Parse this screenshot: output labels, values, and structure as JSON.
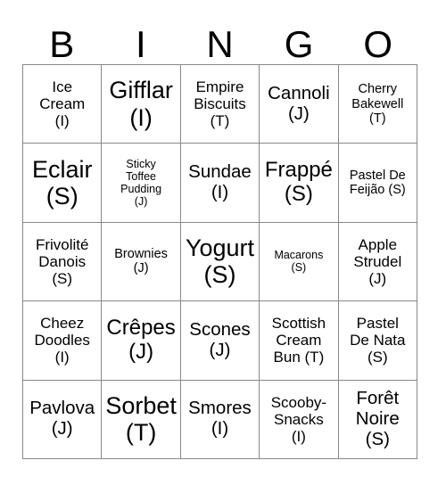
{
  "card": {
    "header": {
      "letters": [
        "B",
        "I",
        "N",
        "G",
        "O"
      ]
    },
    "grid": {
      "rows": 5,
      "columns": 5,
      "cells": [
        {
          "text": "Ice\nCream\n(I)",
          "size": "m"
        },
        {
          "text": "Gifflar\n(I)",
          "size": "xxl"
        },
        {
          "text": "Empire\nBiscuits\n(T)",
          "size": "m"
        },
        {
          "text": "Cannoli\n(J)",
          "size": "l"
        },
        {
          "text": "Cherry\nBakewell\n(T)",
          "size": "s"
        },
        {
          "text": "Eclair\n(S)",
          "size": "xxl"
        },
        {
          "text": "Sticky\nToffee\nPudding\n(J)",
          "size": "xs"
        },
        {
          "text": "Sundae\n(I)",
          "size": "l"
        },
        {
          "text": "Frappé\n(S)",
          "size": "xl"
        },
        {
          "text": "Pastel De\nFeijão (S)",
          "size": "s"
        },
        {
          "text": "Frivolité\nDanois\n(S)",
          "size": "m"
        },
        {
          "text": "Brownies\n(J)",
          "size": "s"
        },
        {
          "text": "Yogurt\n(S)",
          "size": "xxl"
        },
        {
          "text": "Macarons\n(S)",
          "size": "xs"
        },
        {
          "text": "Apple\nStrudel\n(J)",
          "size": "m"
        },
        {
          "text": "Cheez\nDoodles\n(I)",
          "size": "m"
        },
        {
          "text": "Crêpes\n(J)",
          "size": "xl"
        },
        {
          "text": "Scones\n(J)",
          "size": "l"
        },
        {
          "text": "Scottish\nCream\nBun (T)",
          "size": "m"
        },
        {
          "text": "Pastel\nDe Nata\n(S)",
          "size": "m"
        },
        {
          "text": "Pavlova\n(J)",
          "size": "l"
        },
        {
          "text": "Sorbet\n(T)",
          "size": "xxl"
        },
        {
          "text": "Smores\n(I)",
          "size": "l"
        },
        {
          "text": "Scooby-\nSnacks\n(I)",
          "size": "m"
        },
        {
          "text": "Forêt\nNoire\n(S)",
          "size": "l"
        }
      ]
    }
  }
}
